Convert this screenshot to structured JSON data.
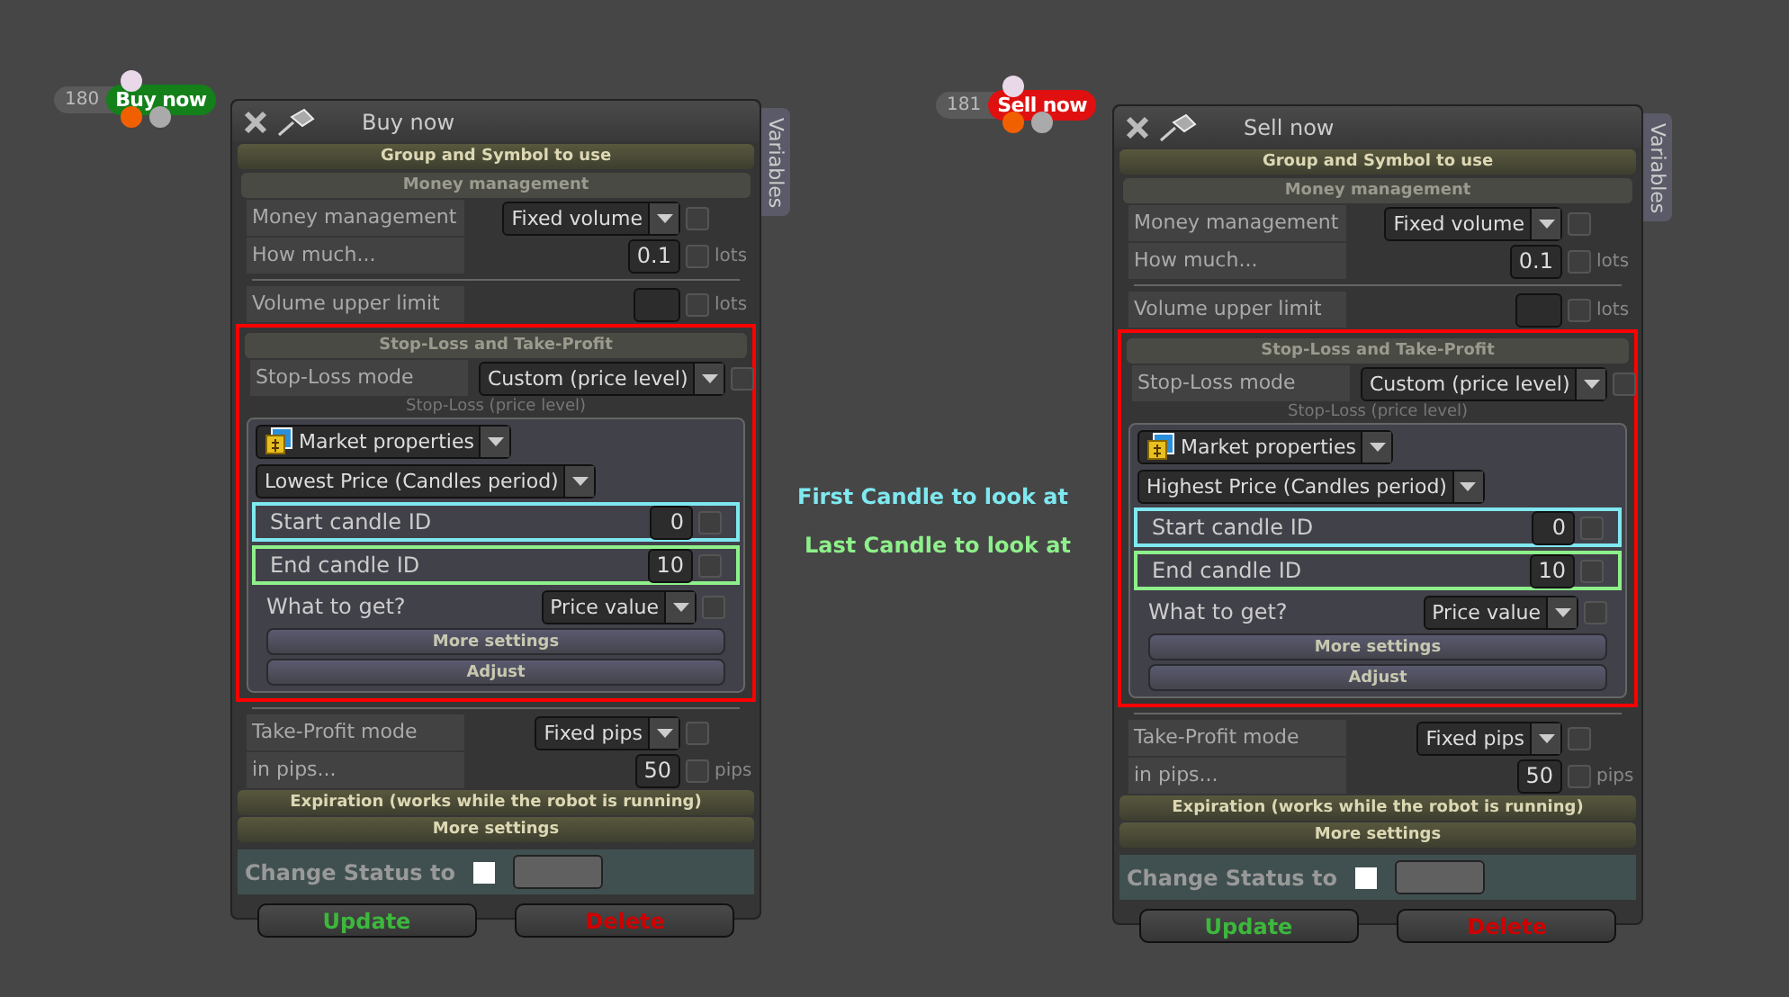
{
  "panels": [
    {
      "badge": {
        "number": "180",
        "label": "Buy now",
        "kind": "buy"
      },
      "title": "Buy now",
      "side_tab": "Variables",
      "group_header": "Group and Symbol to use",
      "money_header": "Money management",
      "money_mode": {
        "label": "Money management",
        "value": "Fixed volume",
        "checked": false
      },
      "how_much": {
        "label": "How much...",
        "value": "0.1",
        "unit": "lots",
        "checked": false
      },
      "volume_limit": {
        "label": "Volume upper limit",
        "unit": "lots",
        "checked": false
      },
      "sl": {
        "header": "Stop-Loss and Take-Profit",
        "color": "#ff0000",
        "mode_label": "Stop-Loss mode",
        "mode_value": "Custom (price level)",
        "mode_checked": false,
        "caption": "Stop-Loss (price level)",
        "source": "Market properties",
        "price_type": "Lowest Price (Candles period)",
        "candle_rows": [
          {
            "label": "Start candle ID",
            "value": "0",
            "checked": false,
            "color": "#7fe8f0"
          },
          {
            "label": "End candle ID",
            "value": "10",
            "checked": false,
            "color": "#8ef08a"
          }
        ],
        "what_label": "What to get?",
        "what_value": "Price value",
        "what_checked": false,
        "buttons": [
          "More settings",
          "Adjust"
        ]
      },
      "tp_mode": {
        "label": "Take-Profit mode",
        "value": "Fixed pips",
        "checked": false
      },
      "in_pips": {
        "label": "in pips...",
        "value": "50",
        "unit": "pips",
        "checked": false
      },
      "expiration": "Expiration (works while the robot is running)",
      "more_settings": "More settings",
      "status": {
        "label": "Change Status to",
        "checked": false
      },
      "actions": [
        {
          "label": "Update",
          "kind": "update"
        },
        {
          "label": "Delete",
          "kind": "delete"
        }
      ]
    },
    {
      "badge": {
        "number": "181",
        "label": "Sell now",
        "kind": "sell"
      },
      "title": "Sell now",
      "side_tab": "Variables",
      "group_header": "Group and Symbol to use",
      "money_header": "Money management",
      "money_mode": {
        "label": "Money management",
        "value": "Fixed volume",
        "checked": false
      },
      "how_much": {
        "label": "How much...",
        "value": "0.1",
        "unit": "lots",
        "checked": false
      },
      "volume_limit": {
        "label": "Volume upper limit",
        "unit": "lots",
        "checked": false
      },
      "sl": {
        "header": "Stop-Loss and Take-Profit",
        "color": "#ff0000",
        "mode_label": "Stop-Loss mode",
        "mode_value": "Custom (price level)",
        "mode_checked": false,
        "caption": "Stop-Loss (price level)",
        "source": "Market properties",
        "price_type": "Highest Price (Candles period)",
        "candle_rows": [
          {
            "label": "Start candle ID",
            "value": "0",
            "checked": false,
            "color": "#7fe8f0"
          },
          {
            "label": "End candle ID",
            "value": "10",
            "checked": false,
            "color": "#8ef08a"
          }
        ],
        "what_label": "What to get?",
        "what_value": "Price value",
        "what_checked": false,
        "buttons": [
          "More settings",
          "Adjust"
        ]
      },
      "tp_mode": {
        "label": "Take-Profit mode",
        "value": "Fixed pips",
        "checked": false
      },
      "in_pips": {
        "label": "in pips...",
        "value": "50",
        "unit": "pips",
        "checked": false
      },
      "expiration": "Expiration (works while the robot is running)",
      "more_settings": "More settings",
      "status": {
        "label": "Change Status to",
        "checked": false
      },
      "actions": [
        {
          "label": "Update",
          "kind": "update"
        },
        {
          "label": "Delete",
          "kind": "delete"
        }
      ]
    }
  ],
  "annotations": [
    {
      "text": "First Candle to look at",
      "color": "#7fe8f0"
    },
    {
      "text": "Last Candle to look at",
      "color": "#8ef08a"
    }
  ]
}
